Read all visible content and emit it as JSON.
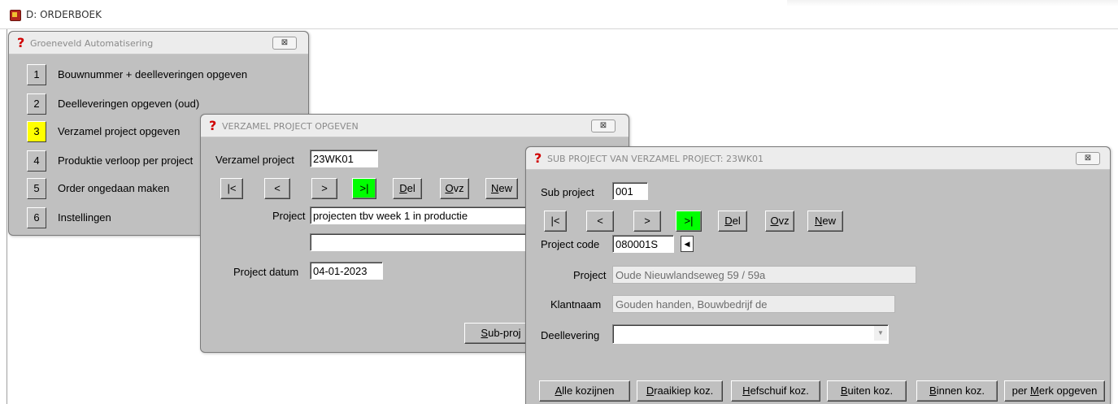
{
  "app": {
    "title": "D: ORDERBOEK"
  },
  "menu_dialog": {
    "title": "Groeneveld Automatisering",
    "close_label": "⊠",
    "items": [
      {
        "num": "1",
        "label": "Bouwnummer + deelleveringen opgeven"
      },
      {
        "num": "2",
        "label": "Deelleveringen opgeven (oud)"
      },
      {
        "num": "3",
        "label": "Verzamel project opgeven"
      },
      {
        "num": "4",
        "label": "Produktie verloop per project"
      },
      {
        "num": "5",
        "label": "Order ongedaan maken"
      },
      {
        "num": "6",
        "label": "Instellingen"
      }
    ]
  },
  "verzamel_dialog": {
    "title": "VERZAMEL PROJECT OPGEVEN",
    "close_label": "⊠",
    "verzamel_project_label": "Verzamel project",
    "verzamel_project_value": "23WK01",
    "nav": {
      "first": "|<",
      "prev": "<",
      "next": ">",
      "last": ">|",
      "del_u": "D",
      "del_rest": "el",
      "ovz_u": "O",
      "ovz_rest": "vz",
      "new_u": "N",
      "new_rest": "ew"
    },
    "project_label": "Project",
    "project_value": "projecten tbv week 1 in productie",
    "project_value2": "",
    "project_datum_label": "Project datum",
    "project_datum_value": "04-01-2023",
    "subproj_u": "S",
    "subproj_rest": "ub-proj"
  },
  "sub_dialog": {
    "title": "SUB PROJECT VAN VERZAMEL PROJECT: 23WK01",
    "close_label": "⊠",
    "sub_project_label": "Sub project",
    "sub_project_value": "001",
    "nav": {
      "first": "|<",
      "prev": "<",
      "next": ">",
      "last": ">|",
      "del_u": "D",
      "del_rest": "el",
      "ovz_u": "O",
      "ovz_rest": "vz",
      "new_u": "N",
      "new_rest": "ew"
    },
    "project_code_label": "Project code",
    "project_code_value": "080001S",
    "project_label": "Project",
    "project_value": "Oude Nieuwlandseweg 59 / 59a",
    "klantnaam_label": "Klantnaam",
    "klantnaam_value": "Gouden handen, Bouwbedrijf de",
    "deellevering_label": "Deellevering",
    "deellevering_value": "",
    "buttons": [
      {
        "u": "A",
        "rest": "lle kozijnen",
        "pre": ""
      },
      {
        "u": "D",
        "rest": "raaikiep koz.",
        "pre": ""
      },
      {
        "u": "H",
        "rest": "efschuif koz.",
        "pre": ""
      },
      {
        "u": "B",
        "rest": "uiten koz.",
        "pre": ""
      },
      {
        "u": "B",
        "rest": "innen koz.",
        "pre": ""
      },
      {
        "u": "M",
        "rest": "erk opgeven",
        "pre": "per "
      }
    ]
  }
}
